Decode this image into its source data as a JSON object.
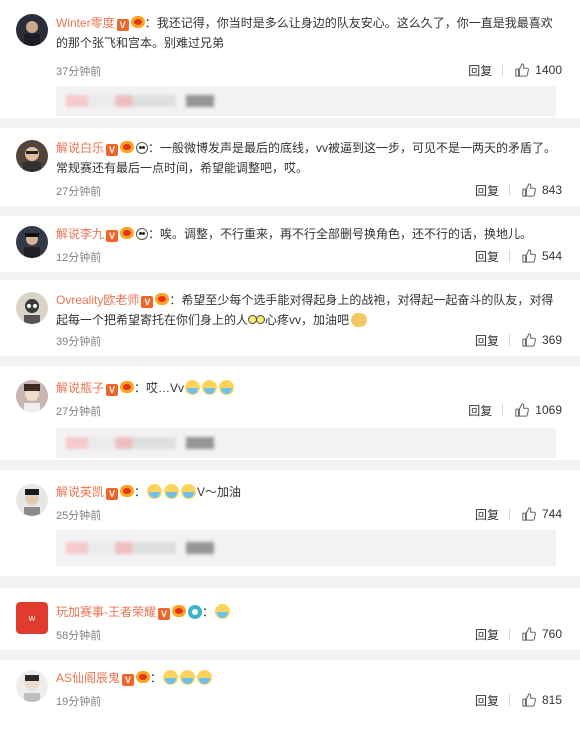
{
  "comments": [
    {
      "user": "Winter零度",
      "text": "我还记得，你当时是多么让身边的队友安心。这么久了，你一直是我最喜欢的那个张飞和宫本。别难过兄弟",
      "time": "37分钟前",
      "reply": "回复",
      "likes": "1400",
      "colors": {
        "avatar": "#2b2d3d"
      }
    },
    {
      "user": "解说白乐",
      "text": "一般微博发声是最后的底线，vv被逼到这一步，可见不是一两天的矛盾了。常规赛还有最后一点时间，希望能调整吧，哎。",
      "time": "27分钟前",
      "reply": "回复",
      "likes": "843",
      "colors": {
        "avatar": "#50443c"
      }
    },
    {
      "user": "解说李九",
      "text": "唉。调整，不行重来，再不行全部删号换角色，还不行的话，换地儿。",
      "time": "12分钟前",
      "reply": "回复",
      "likes": "544",
      "colors": {
        "avatar": "#333a45"
      }
    },
    {
      "user": "Ovreality欧老师",
      "text_a": "希望至少每个选手能对得起身上的战袍，对得起一起奋斗的队友，对得起每一个把希望寄托在你们身上的人",
      "text_b": "心疼vv，加油吧",
      "time": "39分钟前",
      "reply": "回复",
      "likes": "369",
      "colors": {
        "avatar": "#d9d3c8"
      }
    },
    {
      "user": "解说瓶子",
      "text": "哎…Vv",
      "time": "27分钟前",
      "reply": "回复",
      "likes": "1069",
      "colors": {
        "avatar": "#c9b4b0"
      }
    },
    {
      "user": "解说英凯",
      "text": "V～加油",
      "time": "25分钟前",
      "reply": "回复",
      "likes": "744",
      "colors": {
        "avatar": "#8a8a8a"
      }
    },
    {
      "user": "玩加赛事-王者荣耀",
      "text": "",
      "time": "58分钟前",
      "reply": "回复",
      "likes": "760",
      "colors": {
        "avatar": "#e13b2e"
      }
    },
    {
      "user": "AS仙阁辰鬼",
      "text": "",
      "time": "19分钟前",
      "reply": "回复",
      "likes": "815",
      "colors": {
        "avatar": "#d8d8d8"
      }
    }
  ],
  "icons": {
    "like": "thumbs-up-icon",
    "verified": "verified-badge-icon",
    "vip": "vip-badge-icon"
  },
  "colors": {
    "username": "#eb7350",
    "meta": "#808080",
    "subreply_bg": "#f2f2f5"
  }
}
